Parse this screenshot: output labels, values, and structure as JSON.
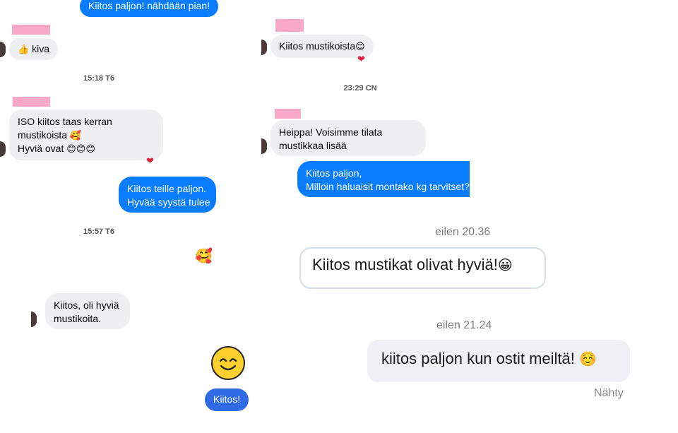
{
  "left": {
    "msg_top_out": "Kiitos paljon! nähdään pian!",
    "msg_kiva": "kiva",
    "thumb_emoji": "👍",
    "stamp1": "15:18 T6",
    "msg_iso_line1": "ISO kiitos taas kerran",
    "msg_iso_line2": "mustikoista",
    "msg_iso_emoji2": "🥰",
    "msg_iso_line3": "Hyviä ovat",
    "msg_iso_emoji3": "😊😊😊",
    "heart": "❤",
    "msg_out2_line1": "Kiitos teille paljon.",
    "msg_out2_line2": "Hyvää syystä tulee",
    "stamp2": "15:57 T6",
    "reaction_emoji": "🥰",
    "msg_oli_line1": "Kiitos, oli hyviä",
    "msg_oli_line2": "mustikoita.",
    "msg_kiitos": "Kiitos!"
  },
  "right": {
    "msg_mustikoista": "Kiitos mustikoista",
    "msg_mustikoista_emoji": "😊",
    "heart": "❤",
    "stamp1": "23:29 CN",
    "msg_heippa_line1": "Heippa! Voisimme tilata",
    "msg_heippa_line2": "mustikkaa lisää",
    "msg_out_line1": "Kiitos paljon,",
    "msg_out_line2": "Milloin haluaisit montako kg tarvitset?",
    "stamp2": "eilen 20.36",
    "msg_hyvia": "Kiitos mustikat olivat hyviä!",
    "msg_hyvia_emoji": "😀",
    "stamp3": "eilen 21.24",
    "msg_meilta": "kiitos paljon kun ostit meiltä!",
    "msg_meilta_emoji": "☺️",
    "seen": "Nähty"
  },
  "colors": {
    "outgoing": "#0a7cff",
    "incoming": "#eeeff1",
    "heart": "#e41e3f",
    "name_redaction": "#f9a8c8"
  },
  "icons": [
    "thumbs-up-icon",
    "heart-icon",
    "smiley-icon",
    "avatar"
  ]
}
